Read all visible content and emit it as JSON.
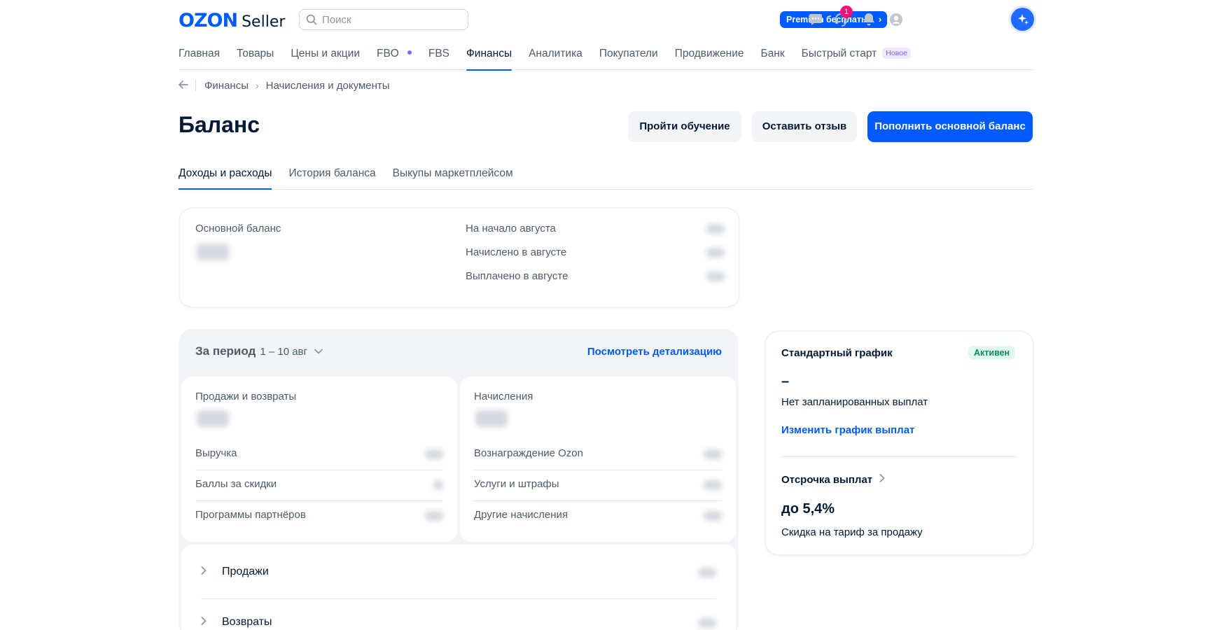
{
  "header": {
    "logo_ozon": "OZON",
    "logo_seller": "Seller",
    "search_placeholder": "Поиск",
    "premium_label": "Premium бесплатно",
    "support_badge": "1"
  },
  "nav": {
    "items": [
      {
        "label": "Главная"
      },
      {
        "label": "Товары"
      },
      {
        "label": "Цены и акции"
      },
      {
        "label": "FBO"
      },
      {
        "label": "FBS"
      },
      {
        "label": "Финансы"
      },
      {
        "label": "Аналитика"
      },
      {
        "label": "Покупатели"
      },
      {
        "label": "Продвижение"
      },
      {
        "label": "Банк"
      },
      {
        "label": "Быстрый старт"
      }
    ],
    "active_item": "Финансы",
    "new_badge": "Новое"
  },
  "breadcrumb": {
    "items": [
      "Финансы",
      "Начисления и документы"
    ]
  },
  "page": {
    "title": "Баланс",
    "btn_learn": "Пройти обучение",
    "btn_feedback": "Оставить отзыв",
    "btn_topup": "Пополнить основной баланс"
  },
  "tabs": {
    "items": [
      {
        "label": "Доходы и расходы"
      },
      {
        "label": "История баланса"
      },
      {
        "label": "Выкупы маркетплейсом"
      }
    ],
    "active": "Доходы и расходы"
  },
  "balance": {
    "main_label": "Основной баланс",
    "rows": [
      {
        "label": "На начало августа"
      },
      {
        "label": "Начислено в августе"
      },
      {
        "label": "Выплачено в августе"
      }
    ]
  },
  "period": {
    "label": "За период",
    "range": "1 – 10 авг",
    "details_link": "Посмотреть детализацию",
    "sales": {
      "title": "Продажи и возвраты",
      "rows": [
        {
          "label": "Выручка"
        },
        {
          "label": "Баллы за скидки"
        },
        {
          "label": "Программы партнёров"
        }
      ]
    },
    "accruals": {
      "title": "Начисления",
      "rows": [
        {
          "label": "Вознаграждение Ozon"
        },
        {
          "label": "Услуги и штрафы"
        },
        {
          "label": "Другие начисления"
        }
      ]
    },
    "groups": [
      {
        "label": "Продажи"
      },
      {
        "label": "Возвраты"
      }
    ]
  },
  "schedule": {
    "title": "Стандартный график",
    "status": "Активен",
    "dash": "–",
    "no_payments": "Нет запланированных выплат",
    "change_link": "Изменить график выплат",
    "deferral_title": "Отсрочка выплат",
    "deferral_value": "до 5,4%",
    "deferral_desc": "Скидка на тариф за продажу"
  },
  "colors": {
    "brand": "#005bff",
    "active_badge_bg": "#e1f8ee",
    "active_badge_text": "#0a8a5a",
    "notification": "#f1117e"
  }
}
